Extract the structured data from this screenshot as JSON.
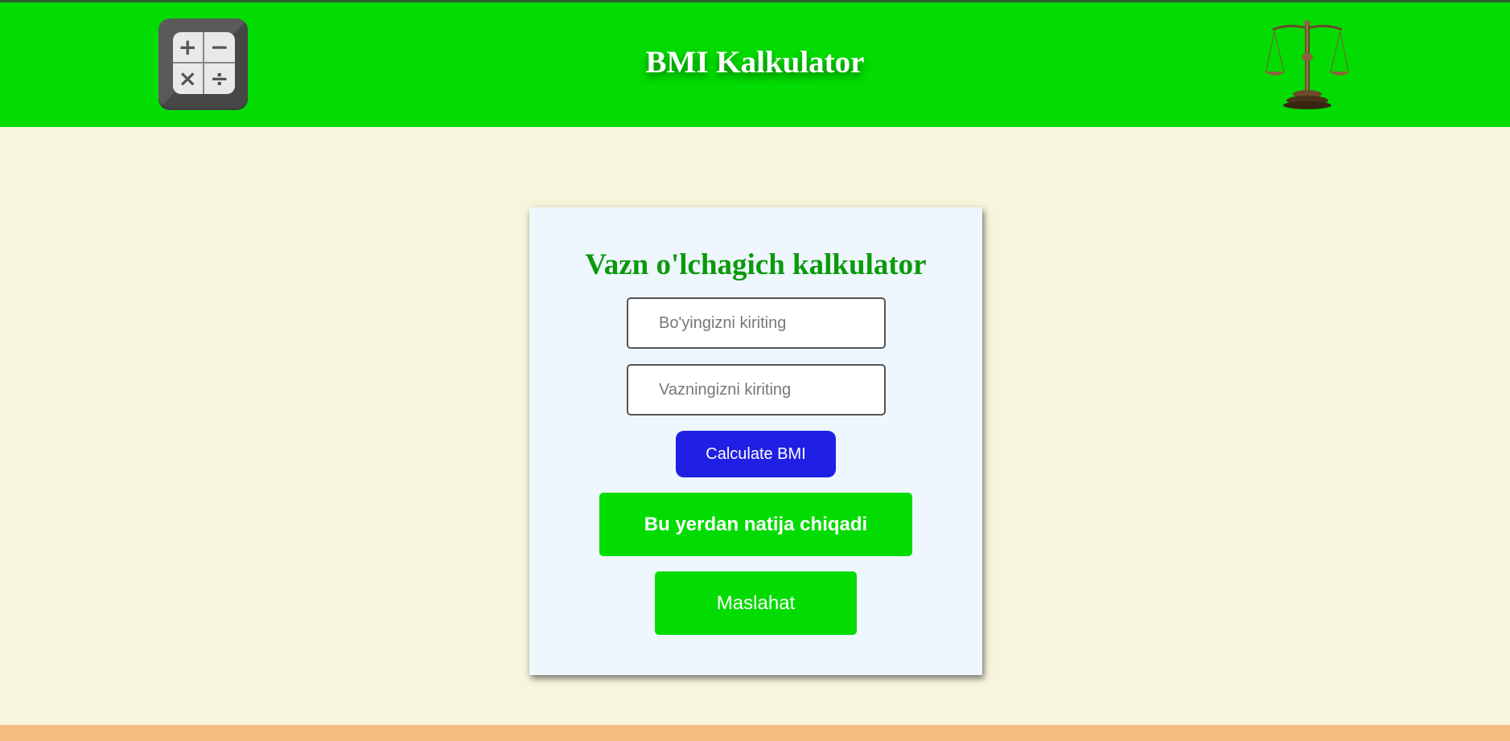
{
  "header": {
    "title": "BMI Kalkulator",
    "left_logo": {
      "icon": "calculator-icon",
      "symbols": [
        "+",
        "−",
        "×",
        "÷"
      ]
    },
    "right_logo": {
      "icon": "scales-icon"
    },
    "background_color": "#02dc02"
  },
  "form": {
    "title": "Vazn o'lchagich kalkulator",
    "height_placeholder": "Bo'yingizni kiriting",
    "weight_placeholder": "Vazningizni kiriting",
    "calculate_label": "Calculate BMI",
    "result_text": "Bu yerdan natija chiqadi",
    "advice_label": "Maslahat"
  },
  "colors": {
    "accent_green": "#02dc02",
    "title_green": "#0a9a0a",
    "button_blue": "#2020e4",
    "page_background": "#f7f5dc",
    "card_background": "#eef6fe",
    "footer": "#f2bd7e"
  }
}
